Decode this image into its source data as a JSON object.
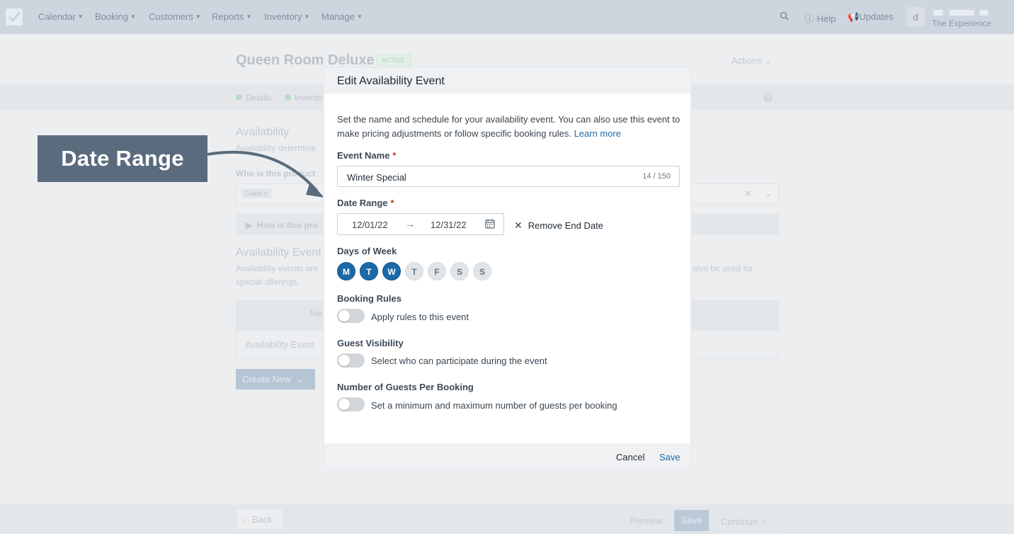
{
  "nav": {
    "items": [
      {
        "label": "Calendar"
      },
      {
        "label": "Booking"
      },
      {
        "label": "Customers"
      },
      {
        "label": "Reports"
      },
      {
        "label": "Inventory"
      },
      {
        "label": "Manage"
      }
    ],
    "help_label": "Help",
    "updates_label": "Updates",
    "avatar_initial": "d",
    "account_name": "The Experience"
  },
  "page": {
    "title": "Queen Room Deluxe",
    "status_badge": "ACTIVE",
    "actions_label": "Actions",
    "steps": [
      {
        "label": "Details"
      },
      {
        "label": "Inventory"
      }
    ],
    "availability_heading": "Availability",
    "availability_desc_fragment": "Availability determine",
    "who_question_fragment": "Who is this product",
    "guest_chip": "Guest",
    "how_fragment": "How is this pro",
    "events_heading_fragment": "Availability Event",
    "events_desc_fragment_1": "Availability events are",
    "events_desc_fragment_2": "special offerings.",
    "events_desc_fragment_right": "also be used for",
    "table_head_fragment": "Nam",
    "table_row_label": "Availability Event",
    "create_new_label": "Create New",
    "back_label": "Back",
    "preview_label": "Preview",
    "save_label": "Save",
    "continue_label": "Continue"
  },
  "callout": {
    "label": "Date Range",
    "color": "#5a6b7d"
  },
  "modal": {
    "title": "Edit Availability Event",
    "intro": "Set the name and schedule for your availability event. You can also use this event to make pricing adjustments or follow specific booking rules.",
    "learn_more": "Learn more",
    "event_name_label": "Event Name",
    "required_marker": "*",
    "event_name_value": "Winter Special",
    "event_name_counter": "14 / 150",
    "date_range_label": "Date Range",
    "start_date": "12/01/22",
    "end_date": "12/31/22",
    "remove_end_date": "Remove End Date",
    "days_label": "Days of Week",
    "days": [
      {
        "label": "M",
        "selected": true
      },
      {
        "label": "T",
        "selected": true
      },
      {
        "label": "W",
        "selected": true
      },
      {
        "label": "T",
        "selected": false
      },
      {
        "label": "F",
        "selected": false
      },
      {
        "label": "S",
        "selected": false
      },
      {
        "label": "S",
        "selected": false
      }
    ],
    "booking_rules_label": "Booking Rules",
    "booking_rules_toggle": "Apply rules to this event",
    "booking_rules_on": false,
    "guest_visibility_label": "Guest Visibility",
    "guest_visibility_toggle": "Select who can participate during the event",
    "guest_visibility_on": false,
    "guests_per_booking_label": "Number of Guests Per Booking",
    "guests_per_booking_toggle": "Set a minimum and maximum number of guests per booking",
    "guests_per_booking_on": false,
    "cancel_label": "Cancel",
    "save_label": "Save",
    "accent_color": "#1a6aa9"
  }
}
